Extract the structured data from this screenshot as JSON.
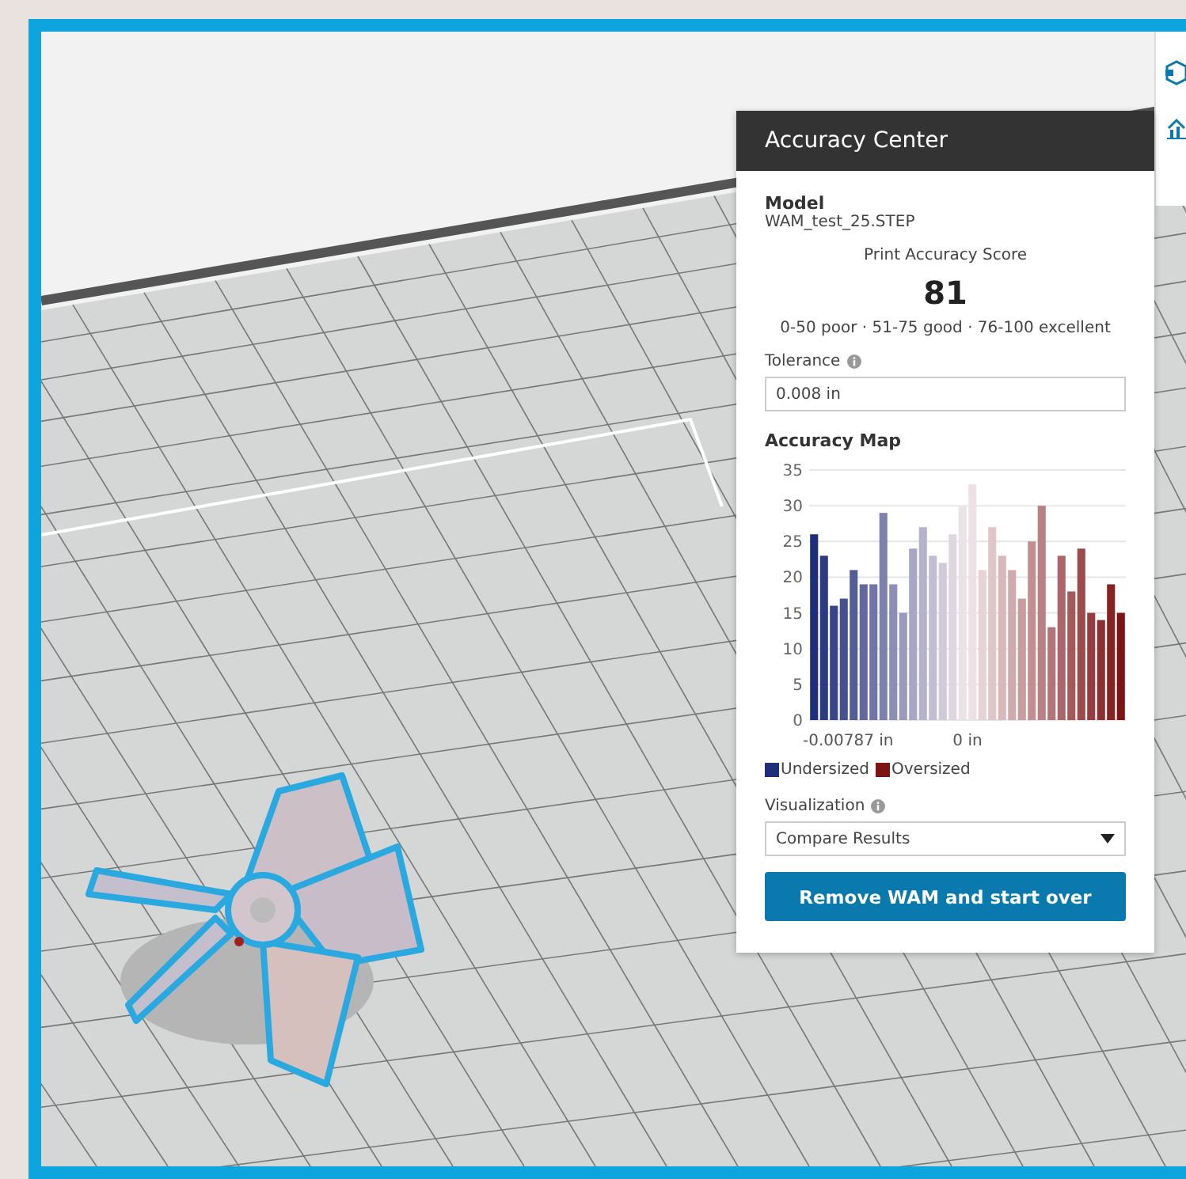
{
  "panel": {
    "title": "Accuracy Center",
    "model_label": "Model",
    "model_file": "WAM_test_25.STEP",
    "score_label": "Print Accuracy Score",
    "score": "81",
    "score_ranges": "0-50 poor · 51-75 good · 76-100 excellent",
    "tolerance_label": "Tolerance",
    "tolerance_value": "0.008 in",
    "map_title": "Accuracy Map",
    "axis_labels": [
      {
        "label": "-0.00787 in"
      },
      {
        "label": "0 in"
      }
    ],
    "chart_data": {
      "type": "bar",
      "grid": true,
      "ylim": [
        0,
        35
      ],
      "yticks": [
        0,
        5,
        10,
        15,
        20,
        25,
        30,
        35
      ],
      "values": [
        26,
        23,
        16,
        17,
        21,
        19,
        19,
        29,
        19,
        15,
        24,
        27,
        23,
        22,
        26,
        30,
        33,
        21,
        27,
        23,
        21,
        17,
        25,
        30,
        13,
        23,
        18,
        24,
        15,
        14,
        19,
        15
      ]
    },
    "legend": [
      {
        "label": "Undersized",
        "color": "#1f2d7a"
      },
      {
        "label": "Oversized",
        "color": "#7d1414"
      }
    ],
    "visualization_label": "Visualization",
    "visualization_value": "Compare Results",
    "action_button": "Remove WAM and start over"
  }
}
